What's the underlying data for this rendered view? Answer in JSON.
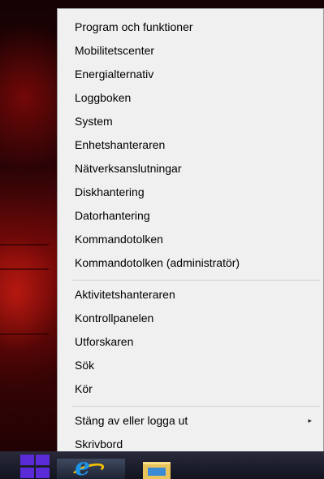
{
  "menu": {
    "groups": [
      {
        "items": [
          {
            "label": "Program och funktioner"
          },
          {
            "label": "Mobilitetscenter"
          },
          {
            "label": "Energialternativ"
          },
          {
            "label": "Loggboken"
          },
          {
            "label": "System"
          },
          {
            "label": "Enhetshanteraren"
          },
          {
            "label": "Nätverksanslutningar"
          },
          {
            "label": "Diskhantering"
          },
          {
            "label": "Datorhantering"
          },
          {
            "label": "Kommandotolken"
          },
          {
            "label": "Kommandotolken (administratör)"
          }
        ]
      },
      {
        "items": [
          {
            "label": "Aktivitetshanteraren"
          },
          {
            "label": "Kontrollpanelen"
          },
          {
            "label": "Utforskaren"
          },
          {
            "label": "Sök"
          },
          {
            "label": "Kör"
          }
        ]
      },
      {
        "items": [
          {
            "label": "Stäng av eller logga ut",
            "submenu_arrow": "▸"
          },
          {
            "label": "Skrivbord"
          }
        ]
      }
    ]
  },
  "taskbar": {
    "icons": [
      "windows-logo-icon",
      "internet-explorer-icon",
      "file-explorer-icon"
    ],
    "start_color": "#5b2bd8"
  },
  "colors": {
    "menu_background": "#f0f0f0",
    "menu_border": "#979797",
    "separator": "#d2d2d2"
  }
}
